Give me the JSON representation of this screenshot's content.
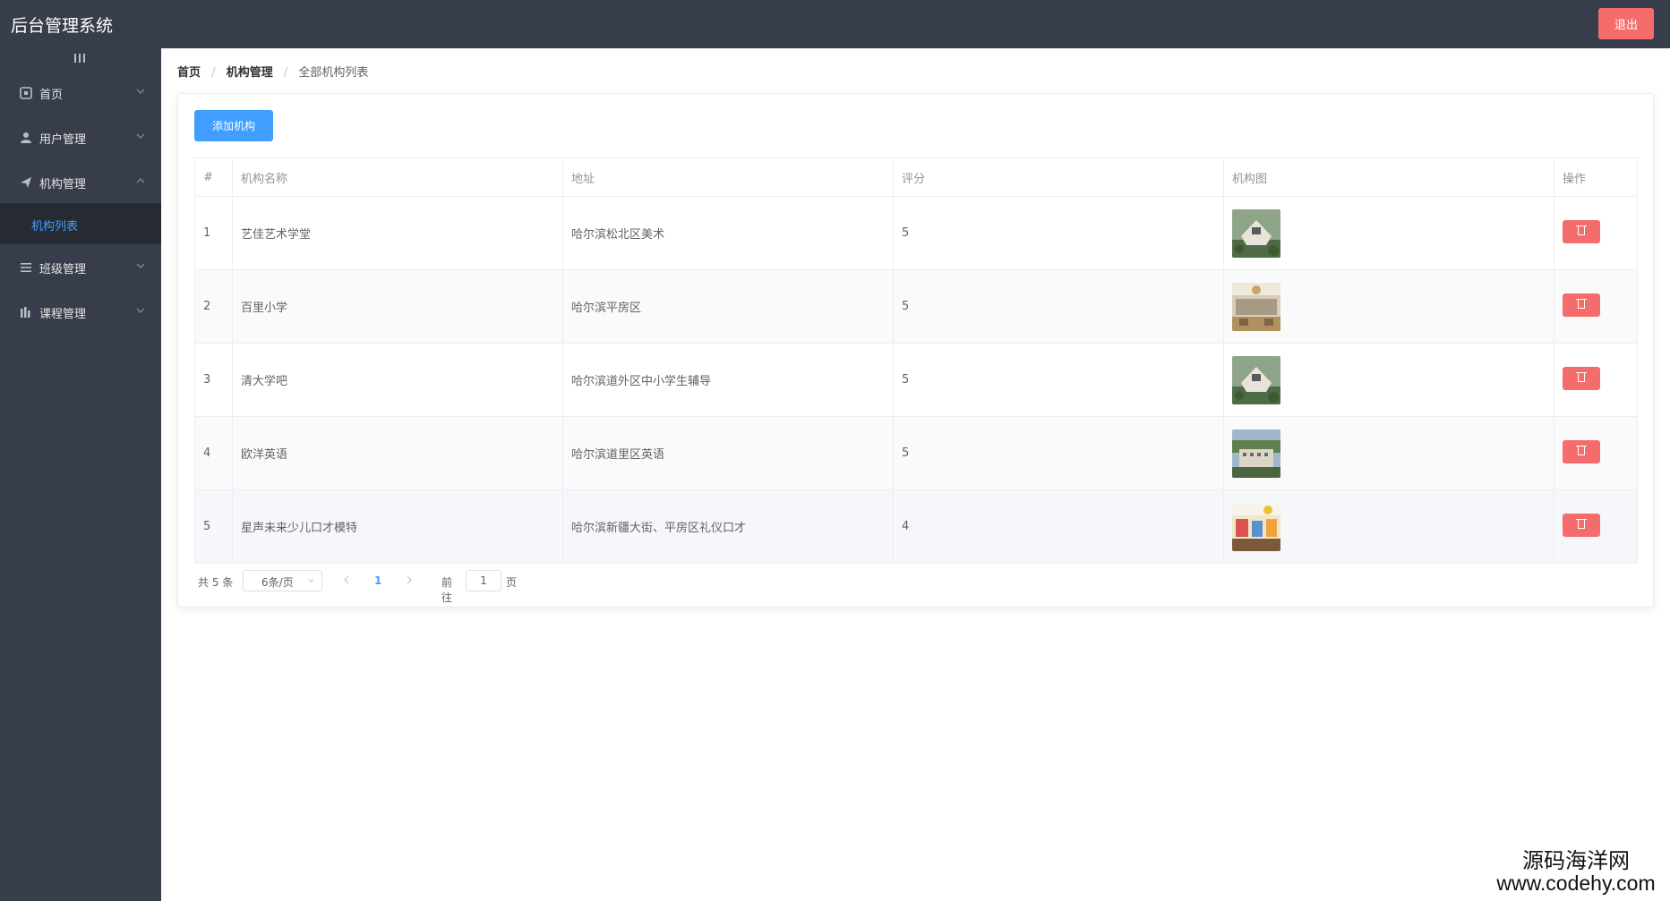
{
  "header": {
    "title": "后台管理系统",
    "logout_label": "退出",
    "logout_color": "#f56c6c",
    "background": "#373d4a"
  },
  "sidebar": {
    "items": [
      {
        "label": "首页",
        "icon": "home-icon",
        "expanded": false
      },
      {
        "label": "用户管理",
        "icon": "user-icon",
        "expanded": false
      },
      {
        "label": "机构管理",
        "icon": "send-icon",
        "expanded": true
      },
      {
        "label": "班级管理",
        "icon": "menu-icon",
        "expanded": false
      },
      {
        "label": "课程管理",
        "icon": "chart-icon",
        "expanded": false
      }
    ],
    "submenu": [
      {
        "label": "机构列表",
        "active": true
      }
    ],
    "active_color": "#409eff"
  },
  "breadcrumb": {
    "items": [
      "首页",
      "机构管理",
      "全部机构列表"
    ],
    "separator": "/"
  },
  "toolbar": {
    "add_label": "添加机构",
    "add_color": "#409eff"
  },
  "table": {
    "headers": [
      "#",
      "机构名称",
      "地址",
      "评分",
      "机构图",
      "操作"
    ],
    "rows": [
      {
        "index": "1",
        "name": "艺佳艺术学堂",
        "address": "哈尔滨松北区美术",
        "score": "5",
        "image": "campus-aerial-image"
      },
      {
        "index": "2",
        "name": "百里小学",
        "address": "哈尔滨平房区",
        "score": "5",
        "image": "classroom-interior-image"
      },
      {
        "index": "3",
        "name": "清大学吧",
        "address": "哈尔滨道外区中小学生辅导",
        "score": "5",
        "image": "campus-aerial-image"
      },
      {
        "index": "4",
        "name": "欧洋英语",
        "address": "哈尔滨道里区英语",
        "score": "5",
        "image": "building-exterior-image"
      },
      {
        "index": "5",
        "name": "星声未来少儿口才模特",
        "address": "哈尔滨新疆大街、平房区礼仪口才",
        "score": "4",
        "image": "kids-playroom-image"
      }
    ],
    "delete_icon": "trash-icon",
    "delete_color": "#f56c6c"
  },
  "pagination": {
    "total_label": "共 5 条",
    "page_size": "6条/页",
    "current_page": "1",
    "goto_label": "前往",
    "goto_value": "1",
    "goto_unit": "页"
  },
  "watermark": {
    "line1": "源码海洋网",
    "line2": "www.codehy.com"
  }
}
